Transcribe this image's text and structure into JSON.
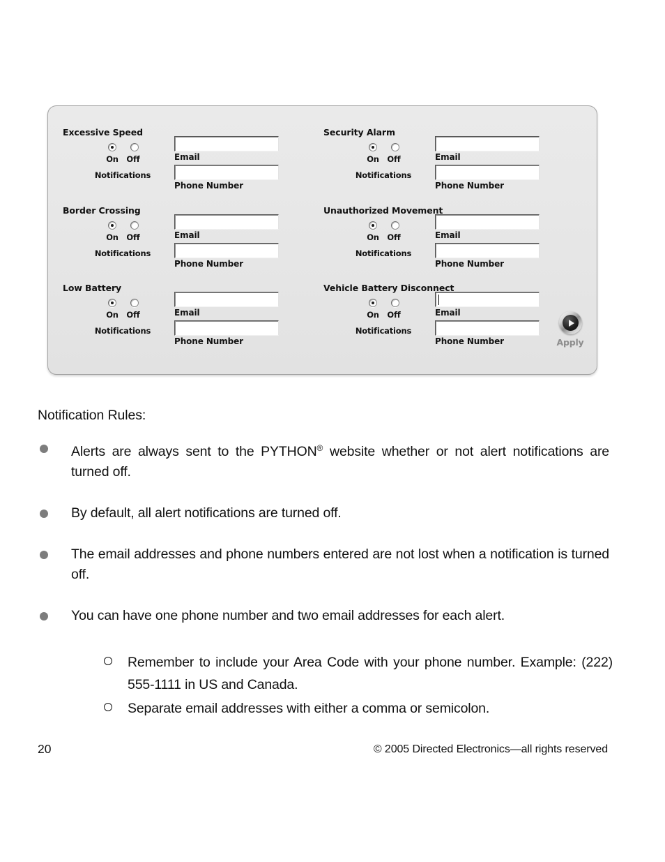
{
  "panel": {
    "apply": {
      "label": "Apply",
      "icon": "play-circle-icon"
    },
    "field_labels": {
      "email": "Email",
      "phone": "Phone Number"
    },
    "radio": {
      "on": "On",
      "off": "Off",
      "caption": "Notifications"
    },
    "alerts": [
      {
        "title": "Excessive Speed",
        "notifications": "On",
        "email_value": "",
        "phone_value": "",
        "focused_field": ""
      },
      {
        "title": "Security Alarm",
        "notifications": "On",
        "email_value": "",
        "phone_value": "",
        "focused_field": ""
      },
      {
        "title": "Border Crossing",
        "notifications": "On",
        "email_value": "",
        "phone_value": "",
        "focused_field": ""
      },
      {
        "title": "Unauthorized Movement",
        "notifications": "On",
        "email_value": "",
        "phone_value": "",
        "focused_field": ""
      },
      {
        "title": "Low Battery",
        "notifications": "On",
        "email_value": "",
        "phone_value": "",
        "focused_field": ""
      },
      {
        "title": "Vehicle Battery Disconnect",
        "notifications": "On",
        "email_value": "",
        "phone_value": "",
        "focused_field": "email"
      }
    ]
  },
  "document": {
    "heading": "Notification Rules:",
    "bullets": [
      "Alerts are always sent to the PYTHON® website whether or not alert notifications are turned off.",
      "By default, all alert notifications are turned off.",
      "The email addresses and phone numbers entered are not lost when a notification is turned off.",
      "You can have one phone number and two email addresses for each alert."
    ],
    "bullet_1_part_a": "Alerts are always sent to the PYTHON",
    "bullet_1_reg": "®",
    "bullet_1_part_b": " website whether or not alert notifications are turned off.",
    "sub_bullets": [
      "Remember to include your Area Code with your phone number. Example: (222) 555-1111 in US and Canada.",
      "Separate email addresses with either a comma or semicolon."
    ]
  },
  "footer": {
    "page_number": "20",
    "copyright": "© 2005 Directed Electronics—all rights reserved"
  }
}
